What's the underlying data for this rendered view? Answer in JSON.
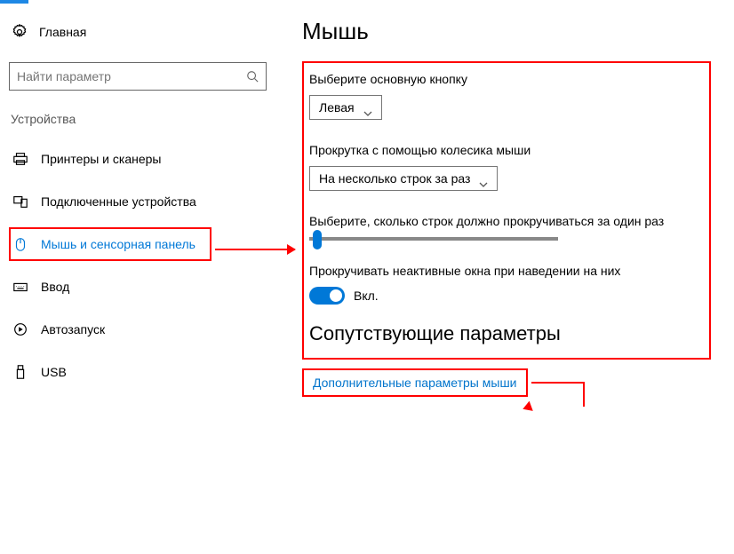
{
  "sidebar": {
    "home_label": "Главная",
    "search_placeholder": "Найти параметр",
    "category": "Устройства",
    "items": [
      {
        "label": "Принтеры и сканеры"
      },
      {
        "label": "Подключенные устройства"
      },
      {
        "label": "Мышь и сенсорная панель"
      },
      {
        "label": "Ввод"
      },
      {
        "label": "Автозапуск"
      },
      {
        "label": "USB"
      }
    ]
  },
  "main": {
    "title": "Мышь",
    "primary_button_label": "Выберите основную кнопку",
    "primary_button_value": "Левая",
    "scroll_mode_label": "Прокрутка с помощью колесика мыши",
    "scroll_mode_value": "На несколько строк за раз",
    "lines_label": "Выберите, сколько строк должно прокручиваться за один раз",
    "inactive_label": "Прокручивать неактивные окна при наведении на них",
    "toggle_state_label": "Вкл.",
    "related_title": "Сопутствующие параметры",
    "additional_link": "Дополнительные параметры мыши"
  }
}
